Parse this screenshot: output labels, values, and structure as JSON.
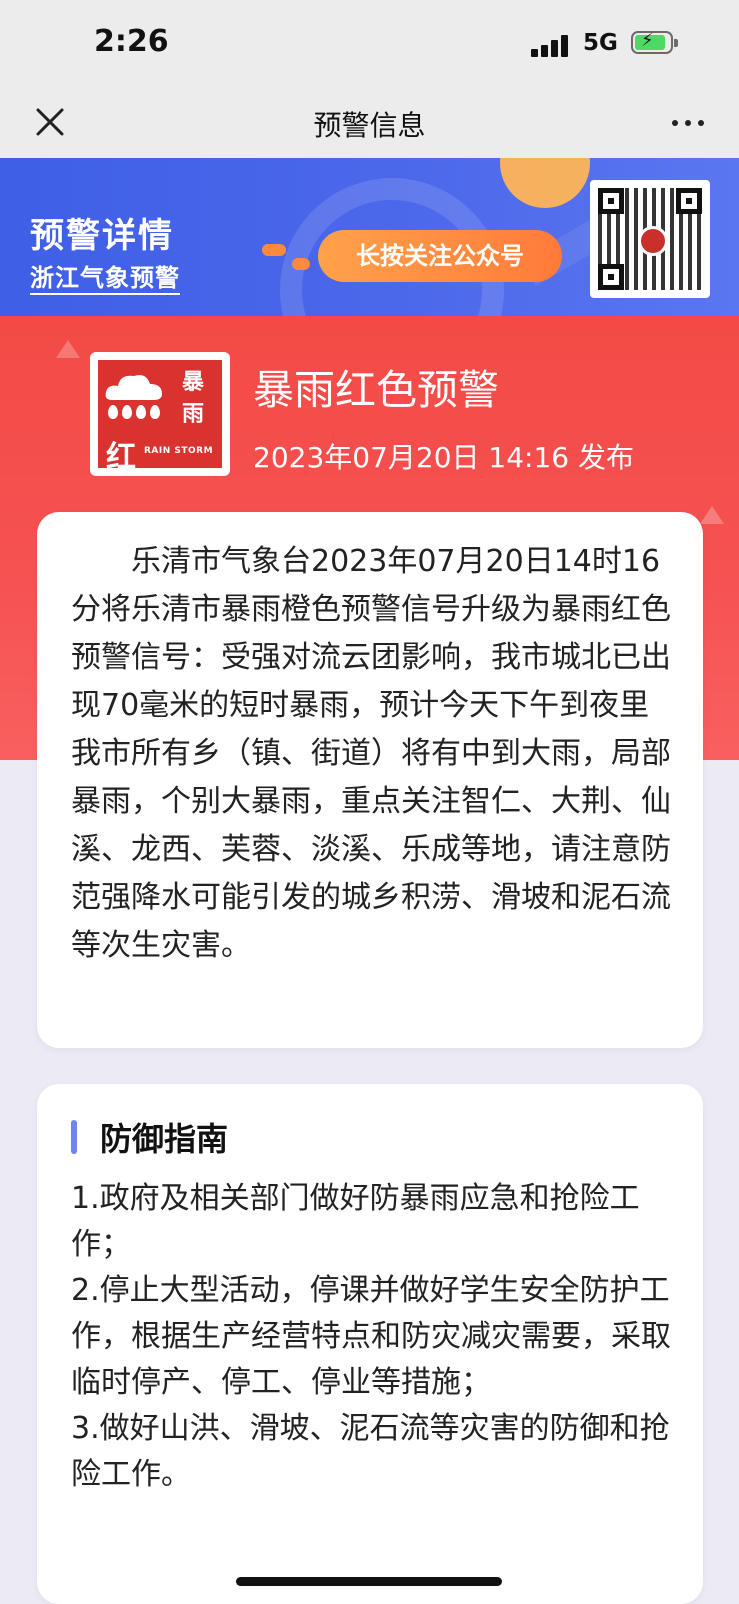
{
  "status_bar": {
    "time": "2:26",
    "network": "5G",
    "battery": "charging"
  },
  "nav": {
    "title": "预警信息",
    "close_icon": "close-icon",
    "more_icon": "more-icon"
  },
  "banner": {
    "title": "预警详情",
    "subtitle": "浙江气象预警",
    "follow_label": "长按关注公众号"
  },
  "alert": {
    "icon": {
      "top_chars": [
        "暴",
        "雨"
      ],
      "color_char": "红",
      "english": "RAIN STORM"
    },
    "title": "暴雨红色预警",
    "published": "2023年07月20日 14:16 发布",
    "detail": "乐清市气象台2023年07月20日14时16分将乐清市暴雨橙色预警信号升级为暴雨红色预警信号：受强对流云团影响，我市城北已出现70毫米的短时暴雨，预计今天下午到夜里我市所有乡（镇、街道）将有中到大雨，局部暴雨，个别大暴雨，重点关注智仁、大荆、仙溪、龙西、芙蓉、淡溪、乐成等地，请注意防范强降水可能引发的城乡积涝、滑坡和泥石流等次生灾害。"
  },
  "guide": {
    "title": "防御指南",
    "items": [
      "1.政府及相关部门做好防暴雨应急和抢险工作；",
      "2.停止大型活动，停课并做好学生安全防护工作，根据生产经营特点和防灾减灾需要，采取临时停产、停工、停业等措施；",
      "3.做好山洪、滑坡、泥石流等灾害的防御和抢险工作。"
    ]
  },
  "colors": {
    "banner_blue": "#4b67ea",
    "alert_red": "#f34a45",
    "accent_orange": "#ff8a3d",
    "guide_bar": "#6f83f2"
  }
}
